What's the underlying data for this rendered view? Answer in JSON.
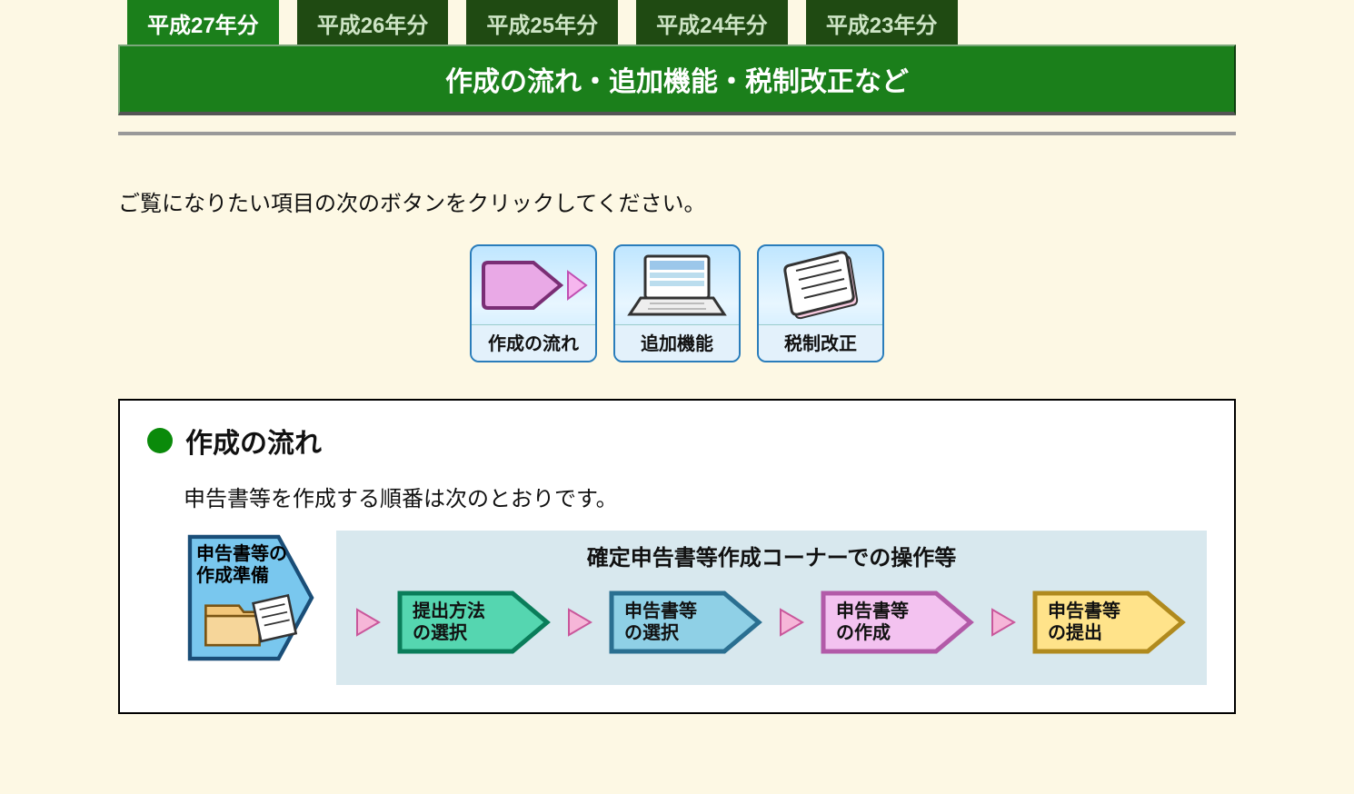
{
  "tabs": [
    {
      "label": "平成27年分",
      "active": true
    },
    {
      "label": "平成26年分",
      "active": false
    },
    {
      "label": "平成25年分",
      "active": false
    },
    {
      "label": "平成24年分",
      "active": false
    },
    {
      "label": "平成23年分",
      "active": false
    }
  ],
  "banner_title": "作成の流れ・追加機能・税制改正など",
  "lead_text": "ご覧になりたい項目の次のボタンをクリックしてください。",
  "icon_buttons": [
    {
      "id": "flow",
      "caption": "作成の流れ"
    },
    {
      "id": "features",
      "caption": "追加機能"
    },
    {
      "id": "tax",
      "caption": "税制改正"
    }
  ],
  "section": {
    "title": "作成の流れ",
    "lead": "申告書等を作成する順番は次のとおりです。",
    "prep_label": "申告書等の\n作成準備",
    "ops_title": "確定申告書等作成コーナーでの操作等",
    "steps": [
      {
        "label": "提出方法\nの選択",
        "fill": "#55d6b0",
        "stroke": "#0a7d5a"
      },
      {
        "label": "申告書等\nの選択",
        "fill": "#8fd0e6",
        "stroke": "#2a6f91"
      },
      {
        "label": "申告書等\nの作成",
        "fill": "#f3c2f0",
        "stroke": "#b25aa8"
      },
      {
        "label": "申告書等\nの提出",
        "fill": "#ffe38a",
        "stroke": "#b08a1e"
      }
    ]
  }
}
